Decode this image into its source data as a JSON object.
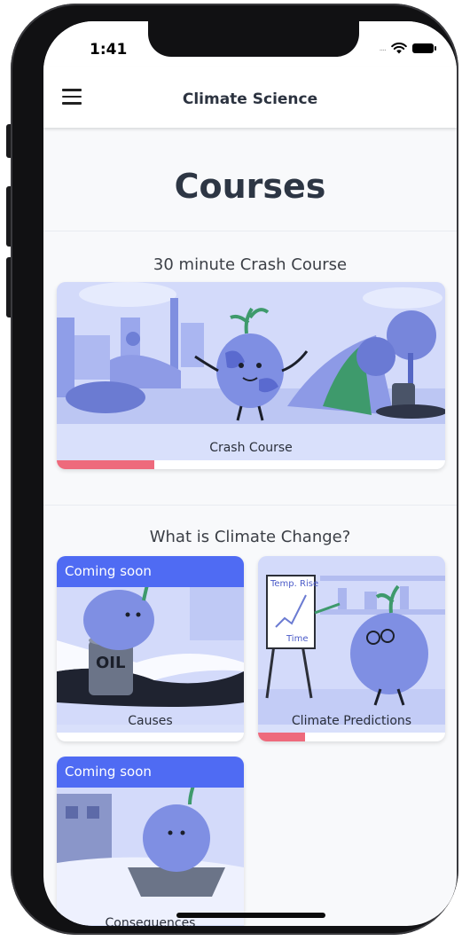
{
  "status_bar": {
    "time": "1:41",
    "signal": "....",
    "icons": [
      "wifi-icon",
      "battery-icon"
    ]
  },
  "nav": {
    "title": "Climate Science",
    "menu_icon": "hamburger-menu-icon"
  },
  "page": {
    "title": "Courses"
  },
  "sections": [
    {
      "title": "30 minute Crash Course",
      "cards": [
        {
          "label": "Crash Course",
          "badge": "",
          "progress": 0.25
        }
      ]
    },
    {
      "title": "What is Climate Change?",
      "cards": [
        {
          "label": "Causes",
          "badge": "Coming soon",
          "progress": 0
        },
        {
          "label": "Climate Predictions",
          "badge": "",
          "progress": 0.25
        },
        {
          "label": "Consequences",
          "badge": "Coming soon",
          "progress": 0
        }
      ]
    }
  ],
  "illustrations": {
    "easel_text_top": "Temp. Rise",
    "easel_text_bottom": "Time",
    "barrel_text": "OIL"
  },
  "colors": {
    "accent": "#4f6bf3",
    "progress": "#ee6a7c",
    "card_bg": "#d9e0fb",
    "title": "#2d3644"
  }
}
